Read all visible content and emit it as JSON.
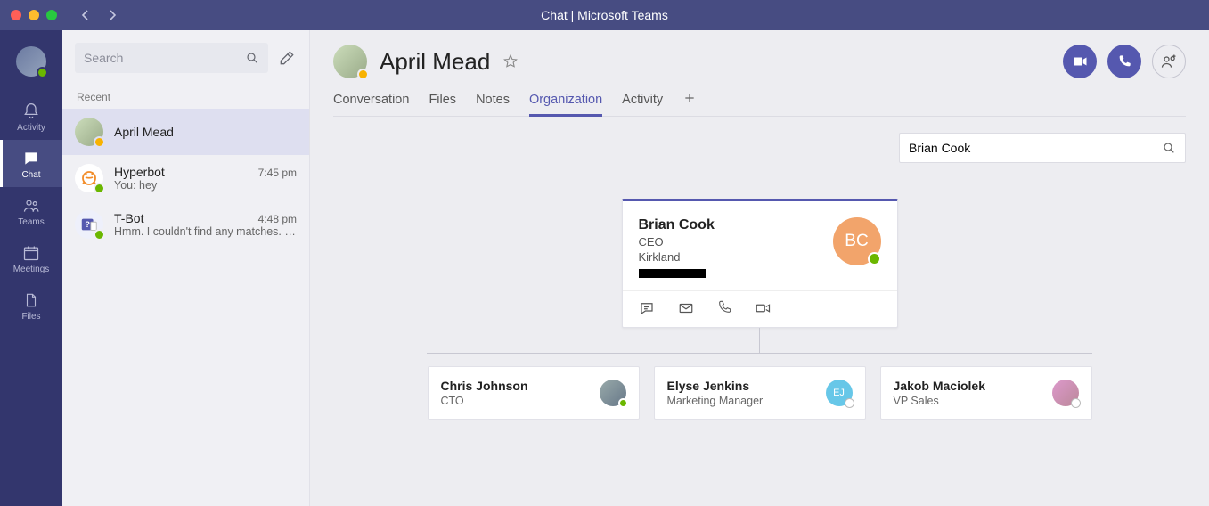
{
  "window": {
    "title": "Chat | Microsoft Teams"
  },
  "rail": {
    "activity": "Activity",
    "chat": "Chat",
    "teams": "Teams",
    "meetings": "Meetings",
    "files": "Files"
  },
  "chatlist": {
    "search_placeholder": "Search",
    "section": "Recent",
    "items": [
      {
        "name": "April Mead",
        "time": "",
        "preview": ""
      },
      {
        "name": "Hyperbot",
        "time": "7:45 pm",
        "preview": "You: hey"
      },
      {
        "name": "T-Bot",
        "time": "4:48 pm",
        "preview": "Hmm. I couldn't find any matches. C…"
      }
    ]
  },
  "header": {
    "title": "April Mead",
    "tabs": {
      "conversation": "Conversation",
      "files": "Files",
      "notes": "Notes",
      "organization": "Organization",
      "activity": "Activity"
    }
  },
  "org": {
    "search_value": "Brian Cook",
    "manager": {
      "name": "Brian Cook",
      "role": "CEO",
      "location": "Kirkland",
      "initials": "BC"
    },
    "reports": [
      {
        "name": "Chris Johnson",
        "role": "CTO"
      },
      {
        "name": "Elyse Jenkins",
        "role": "Marketing Manager",
        "initials": "EJ"
      },
      {
        "name": "Jakob Maciolek",
        "role": "VP Sales"
      }
    ]
  }
}
